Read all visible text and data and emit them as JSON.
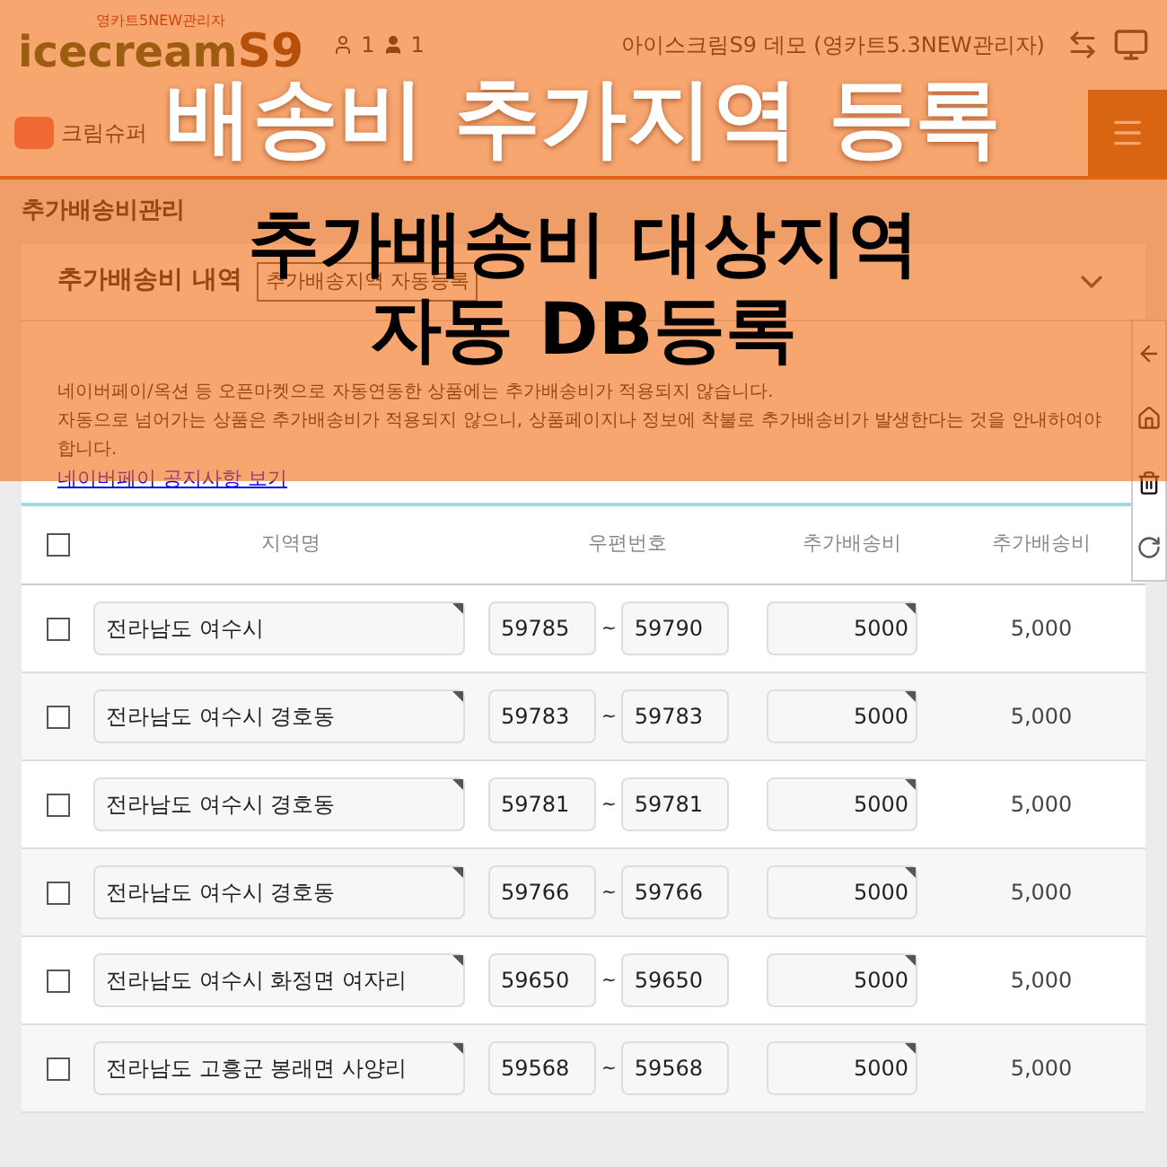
{
  "banner": {
    "title": "배송비 추가지역 등록",
    "subtitle_lines": [
      "추가배송비 대상지역",
      "자동 DB등록"
    ]
  },
  "header": {
    "logo_small": "영카트5NEW관리자",
    "logo": "icecream",
    "logo_accent": "S9",
    "counts": [
      "1",
      "1"
    ],
    "site": "아이스크림S9 데모 (영카트5.3NEW관리자)"
  },
  "nav": {
    "items": [
      "크림슈퍼"
    ]
  },
  "page_title": "추가배송비관리",
  "filter": {
    "label": "추가배송비 내역",
    "value": "추가배송지역 자동등록"
  },
  "notice": {
    "lines": [
      "네이버페이/옥션 등 오픈마켓으로 자동연동한 상품에는 추가배송비가 적용되지 않습니다.",
      "자동으로 넘어가는 상품은 추가배송비가 적용되지 않으니, 상품페이지나 정보에 착불로 추가배송비가 발생한다는 것을 안내하여야 합니다."
    ],
    "link": "네이버페이 공지사항 보기"
  },
  "table": {
    "all_checked": false,
    "columns": [
      "지역명",
      "우편번호",
      "추가배송비",
      "추가배송비"
    ],
    "rows": [
      {
        "checked": false,
        "region": "전라남도 여수시",
        "zip_from": "59785",
        "zip_to": "59790",
        "fee_input": "5000",
        "fee": "5,000"
      },
      {
        "checked": false,
        "region": "전라남도 여수시 경호동",
        "zip_from": "59783",
        "zip_to": "59783",
        "fee_input": "5000",
        "fee": "5,000"
      },
      {
        "checked": false,
        "region": "전라남도 여수시 경호동",
        "zip_from": "59781",
        "zip_to": "59781",
        "fee_input": "5000",
        "fee": "5,000"
      },
      {
        "checked": false,
        "region": "전라남도 여수시 경호동",
        "zip_from": "59766",
        "zip_to": "59766",
        "fee_input": "5000",
        "fee": "5,000"
      },
      {
        "checked": false,
        "region": "전라남도 여수시 화정면 여자리",
        "zip_from": "59650",
        "zip_to": "59650",
        "fee_input": "5000",
        "fee": "5,000"
      },
      {
        "checked": false,
        "region": "전라남도 고흥군 봉래면 사양리",
        "zip_from": "59568",
        "zip_to": "59568",
        "fee_input": "5000",
        "fee": "5,000"
      }
    ],
    "separator": "~"
  }
}
